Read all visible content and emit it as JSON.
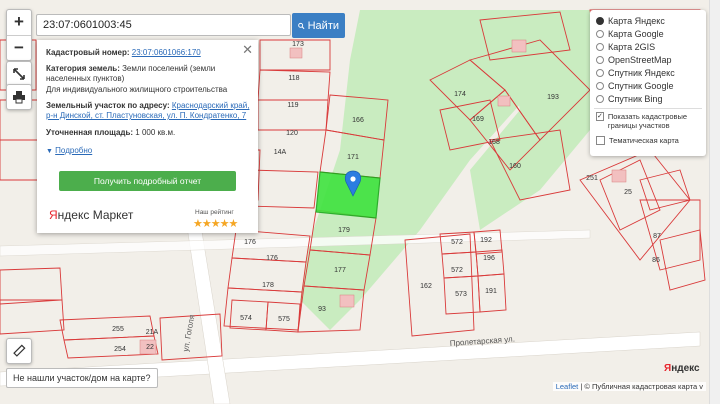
{
  "search": {
    "value": "23:07:0601003:45",
    "button_label": "Найти"
  },
  "zoom": {
    "in": "+",
    "out": "−"
  },
  "popup": {
    "cad_label": "Кадастровый номер:",
    "cad_value": "23:07:0601066:170",
    "cat_label": "Категория земель:",
    "cat_value": "Земли поселений (земли населенных пунктов)",
    "use_value": "Для индивидуального жилищного строительства",
    "addr_label": "Земельный участок по адресу:",
    "addr_value": "Краснодарский край, р-н Динской, ст. Пластуновская, ул. П. Кондратенко, 7",
    "area_label": "Уточненная площадь:",
    "area_value": "1 000 кв.м.",
    "more_link": "Подробно",
    "report_button": "Получить подробный отчет",
    "logo_ya": "Я",
    "logo_rest": "ндекс Маркет",
    "rating_label": "Наш рейтинг",
    "stars": "★★★★★",
    "close": "✕"
  },
  "layers": {
    "options": [
      {
        "label": "Карта Яндекс",
        "selected": true
      },
      {
        "label": "Карта Google",
        "selected": false
      },
      {
        "label": "Карта 2GIS",
        "selected": false
      },
      {
        "label": "OpenStreetMap",
        "selected": false
      },
      {
        "label": "Спутник Яндекс",
        "selected": false
      },
      {
        "label": "Спутник Google",
        "selected": false
      },
      {
        "label": "Спутник Bing",
        "selected": false
      }
    ],
    "overlay_cadastral": "Показать кадастровые границы участков",
    "overlay_thematic": "Тематическая карта",
    "overlay_cadastral_checked": true,
    "overlay_thematic_checked": false
  },
  "not_found": "Не нашли участок/дом на карте?",
  "attribution": {
    "leaflet": "Leaflet",
    "sep": " | ",
    "copy": "© Публичная кадастровая карта",
    "ver": "v"
  },
  "yandex_logo": {
    "first": "Я",
    "rest": "ндекс"
  },
  "streets": {
    "gogol": "ул. Гоголя",
    "proletarskaya": "Пролетарская ул."
  },
  "plots": [
    "173",
    "118",
    "119",
    "120",
    "166",
    "171",
    "179",
    "177",
    "176",
    "176",
    "178",
    "574",
    "575",
    "93",
    "174",
    "193",
    "169",
    "168",
    "160",
    "572",
    "192",
    "572",
    "196",
    "162",
    "573",
    "191",
    "251",
    "25",
    "87",
    "86",
    "255",
    "254",
    "21А",
    "22",
    "14А"
  ],
  "colors": {
    "plot_line": "#d93a3a",
    "selected_fill": "#3fe33f",
    "selected_line": "#1ea81e",
    "park": "#c9ecc0",
    "road": "#ffffff",
    "button_blue": "#3b7fc4",
    "report_green": "#4cae4c"
  }
}
